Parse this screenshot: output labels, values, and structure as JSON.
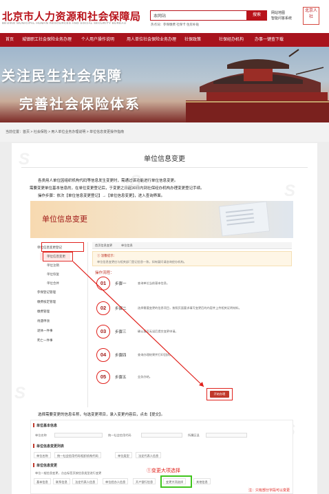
{
  "header": {
    "logo_cn": "北京市人力资源和社会保障局",
    "logo_en": "BEIJING MUNICIPAL HUMAN RESOURCES AND SOCIAL SECURITY BUREAU",
    "search_value": "本网站",
    "search_button": "搜索",
    "hot_search": "热点词：参保缴费  社保卡  住房补贴",
    "links": [
      "网站地图",
      "智能问答系统"
    ],
    "emblem": "北京人社"
  },
  "nav": [
    "首页",
    "城镇职工社会保险业务办理",
    "个人用户操作说明",
    "用人单位社会保险业务办理",
    "社保政策",
    "社保经办机构",
    "办事一键查下载"
  ],
  "banner": {
    "line1": "关注民生社会保障",
    "line2": "完善社会保险体系"
  },
  "breadcrumb": "当前位置：首页 > 社会保险 > 用人单位业务办理说明 > 单位信息变更操作指南",
  "article": {
    "title": "单位信息变更",
    "para1": "各类用人单位因组织机构代码等信息发生变更时，需通过该功能进行单位信息变更。",
    "para2": "需要变更单位基本信息的，在单位变更登记后，于变更之日起30日内到社保经办机构办理变更登记手续。",
    "para3": "操作步骤：依次【单位信息变更登记】→【单位信息变更】，进入查询界面。",
    "para4": "选择需要变更的信息名称，勾选变更项目，录入变更内容后，点击【提交】。"
  },
  "shot1": {
    "banner_title": "单位信息变更",
    "side_items": [
      "单位信息变更登记",
      "单位信息变更",
      "单位注销",
      "单位恢复",
      "单位合并",
      "参保登记管理",
      "缴费核定管理",
      "缴费管理",
      "待遇申领",
      "退休一件事",
      "死亡一件事"
    ],
    "tabs": [
      "首页信息变更",
      "单位信息"
    ],
    "tip_title": "① 温馨提示：",
    "tip_text": "单位信息变更应与相关部门登记信息一致，如有疑问请咨询经办机构。",
    "flow_label": "操作流程：",
    "steps": [
      {
        "num": "01",
        "name": "步骤一",
        "desc": "查询单位当前基本信息。"
      },
      {
        "num": "02",
        "name": "步骤二",
        "desc": "选择需要变更的信息项目，按照页面要求填写变更后的内容并上传相关证明材料。"
      },
      {
        "num": "03",
        "name": "步骤三",
        "desc": "确认填写无误后提交变更申请。"
      },
      {
        "num": "04",
        "name": "步骤四",
        "desc": "查询办理结果并打印回执。"
      },
      {
        "num": "05",
        "name": "步骤五",
        "desc": "业务办结。"
      }
    ],
    "go_button": "开始办理"
  },
  "shot2": {
    "section1": "单位基本信息",
    "labels1": [
      "单位名称",
      "统一社会信用代码",
      "所属区县"
    ],
    "section2": "单位信息变更列表",
    "tabs2": [
      "单位名称",
      "统一社会信用代码/组织机构代码",
      "单位类型",
      "法定代表人信息"
    ],
    "section3": "单位信息变更",
    "sub_note": "单位一般信息变更，点击标签页按信息类型进行变更",
    "tabs3": [
      "基本信息",
      "联系信息",
      "法定代表人信息",
      "单位经办人信息",
      "开户银行信息",
      "变更大项选择",
      "其他信息"
    ],
    "callout": "①变更大项选择",
    "callout2": "注：只有部分字段可以变更"
  },
  "colors": {
    "brand": "#b8121a",
    "nav": "#a8131d",
    "highlight_box": "#e0201b",
    "green_box": "#3fc41c"
  }
}
